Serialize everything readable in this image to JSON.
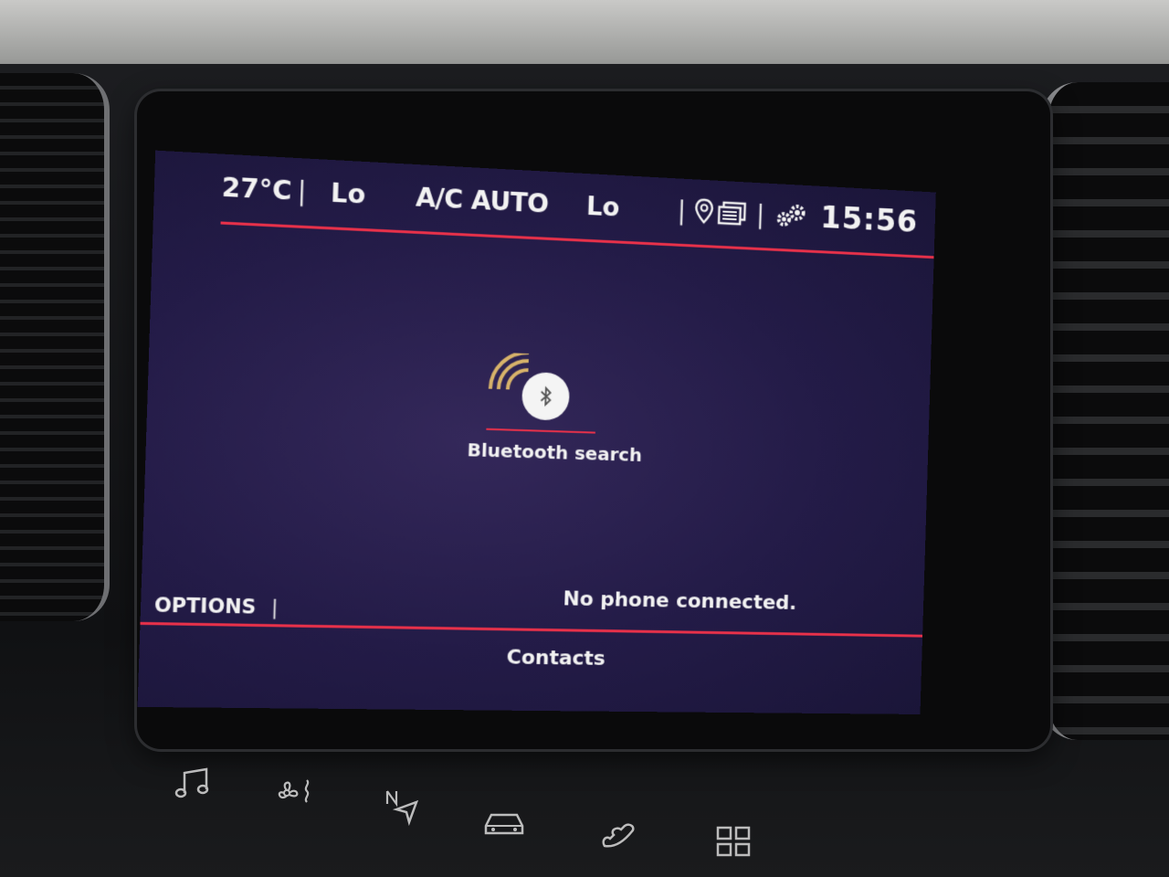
{
  "status_bar": {
    "temperature": "27°C",
    "fan_left": "Lo",
    "ac_mode": "A/C AUTO",
    "fan_right": "Lo",
    "clock": "15:56",
    "icons": [
      "location-pin-icon",
      "notifications-icon",
      "settings-gears-icon"
    ]
  },
  "bluetooth": {
    "label": "Bluetooth search",
    "icon": "bluetooth-search-icon"
  },
  "status_message": "No phone connected.",
  "bottom_bar": {
    "options_label": "OPTIONS",
    "contacts_label": "Contacts"
  },
  "hard_buttons": [
    "music-icon",
    "climate-fan-icon",
    "navigation-icon",
    "vehicle-icon",
    "phone-icon",
    "apps-grid-icon"
  ],
  "colors": {
    "accent_red": "#e8314a",
    "screen_bg": "#231b47",
    "bt_wave": "#d8b36a"
  }
}
